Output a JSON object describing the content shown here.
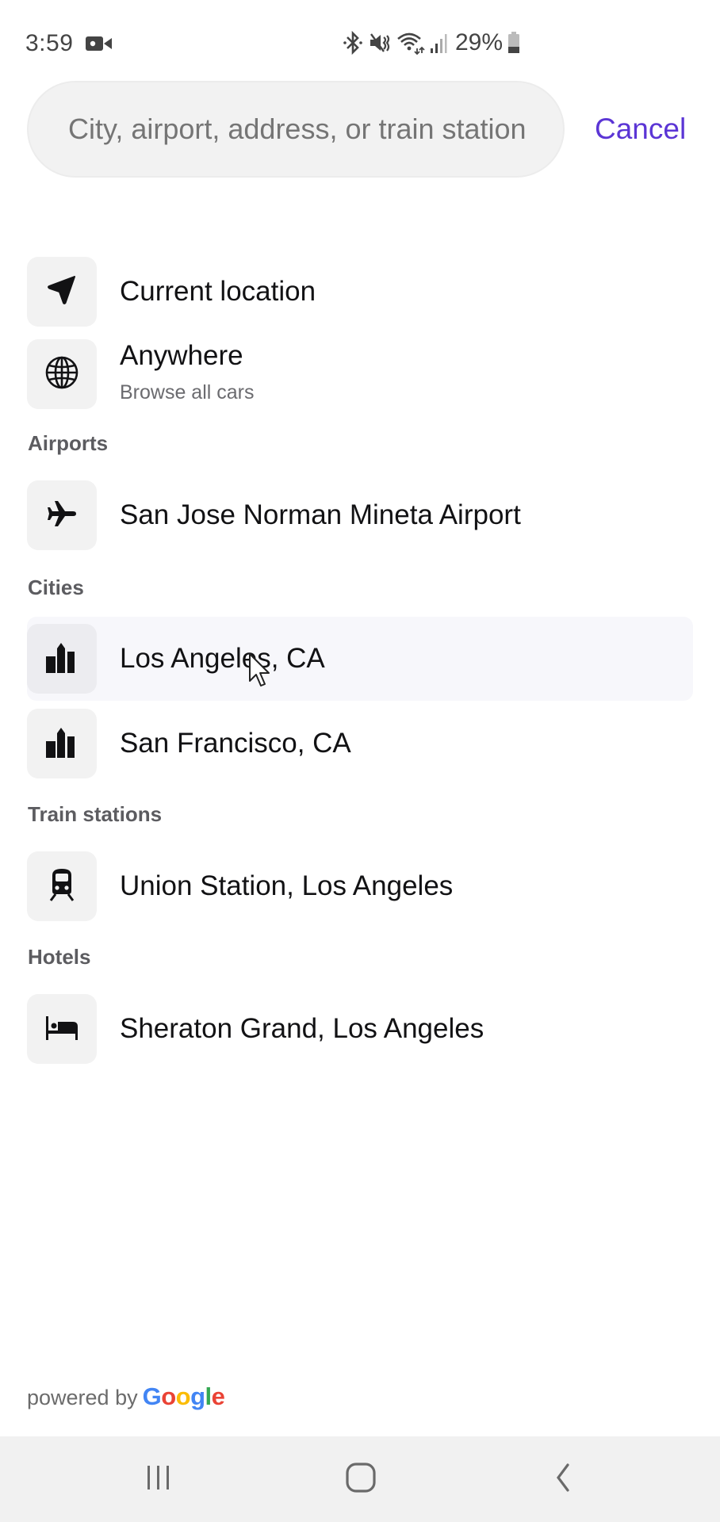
{
  "status_bar": {
    "time": "3:59",
    "battery_percent": "29%",
    "icons": [
      "video-camera-icon",
      "bluetooth-icon",
      "mute-icon",
      "wifi-icon",
      "signal-icon",
      "battery-icon"
    ]
  },
  "search": {
    "placeholder": "City, airport, address, or train station",
    "value": "",
    "cancel_label": "Cancel"
  },
  "quick_options": [
    {
      "label": "Current location",
      "icon": "navigation-arrow-icon"
    },
    {
      "label": "Anywhere",
      "sublabel": "Browse all cars",
      "icon": "globe-icon"
    }
  ],
  "sections": [
    {
      "title": "Airports",
      "items": [
        {
          "label": "San Jose Norman Mineta Airport",
          "icon": "airplane-icon"
        }
      ]
    },
    {
      "title": "Cities",
      "items": [
        {
          "label": "Los Angeles, CA",
          "icon": "city-icon",
          "highlighted": true
        },
        {
          "label": "San Francisco, CA",
          "icon": "city-icon"
        }
      ]
    },
    {
      "title": "Train stations",
      "items": [
        {
          "label": "Union Station, Los Angeles",
          "icon": "train-icon"
        }
      ]
    },
    {
      "title": "Hotels",
      "items": [
        {
          "label": "Sheraton Grand, Los Angeles",
          "icon": "bed-icon"
        }
      ]
    }
  ],
  "footer": {
    "powered_by": "powered by",
    "brand_letters": [
      "G",
      "o",
      "o",
      "g",
      "l",
      "e"
    ],
    "brand_colors": [
      "#4285F4",
      "#EA4335",
      "#FBBC05",
      "#4285F4",
      "#34A853",
      "#EA4335"
    ]
  },
  "nav_bar": {
    "buttons": [
      "recent-apps",
      "home",
      "back"
    ]
  },
  "colors": {
    "accent": "#5b35d5",
    "highlight_row": "#f7f7fb",
    "icon_box": "#f2f2f2"
  }
}
